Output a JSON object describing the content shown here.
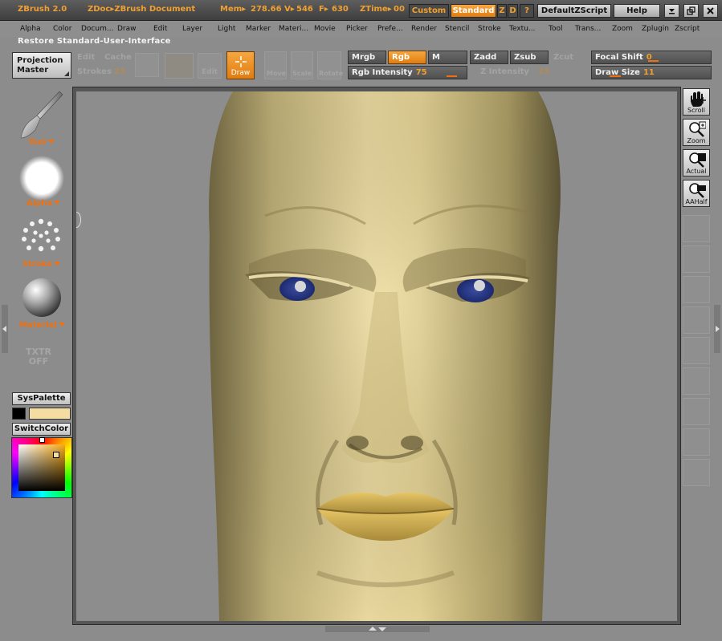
{
  "titlebar": {
    "app_name": "ZBrush 2.0",
    "document": "ZDoc▸ZBrush Document",
    "mem_label": "Mem▸",
    "mem_value": "278.66",
    "v_label": "V▸",
    "v_value": "546",
    "f_label": "F▸",
    "f_value": "630",
    "ztime_label": "ZTime▸",
    "ztime_value": "00",
    "custom": "Custom",
    "standard": "Standard",
    "z": "Z",
    "d": "D",
    "help_q": "?",
    "script": "DefaultZScript",
    "help": "Help",
    "minimize": "—",
    "restore": "❐",
    "close": "✕"
  },
  "menu": [
    "Alpha",
    "Color",
    "Docum...",
    "Draw",
    "Edit",
    "Layer",
    "Light",
    "Marker",
    "Materi...",
    "Movie",
    "Picker",
    "Prefe...",
    "Render",
    "Stencil",
    "Stroke",
    "Textu...",
    "Tool",
    "Trans...",
    "Zoom",
    "Zplugin",
    "Zscript"
  ],
  "status_text": "Restore Standard-User-Interface",
  "toolbar": {
    "projection_master": [
      "Projection",
      "Master"
    ],
    "edit": "Edit",
    "move": "Move",
    "scale": "Scale",
    "rotate": "Rotate",
    "draw": "Draw",
    "edit_faded": "Edit",
    "strokes": "Strokes",
    "strokes_value": "25",
    "cache": "Cache",
    "mrgb": "Mrgb",
    "rgb": "Rgb",
    "m": "M",
    "zadd": "Zadd",
    "zsub": "Zsub",
    "zcut": "Zcut",
    "rgb_intensity": "Rgb Intensity",
    "rgb_intensity_value": "75",
    "z_intensity": "Z Intensity",
    "z_intensity_value": "25",
    "focal_shift": "Focal Shift",
    "focal_shift_value": "0",
    "draw_size": "Draw Size",
    "draw_size_value": "11"
  },
  "left_shelf": {
    "tool": "Tool",
    "alpha": "Alpha",
    "stroke": "Stroke",
    "material": "Material",
    "texture_off": [
      "TXTR",
      "OFF"
    ],
    "syspalette": "SysPalette",
    "switchcolor": "SwitchColor",
    "main_color": "#f5dca0",
    "secondary_color": "#000000"
  },
  "right_shelf": {
    "scroll": "Scroll",
    "zoom": "Zoom",
    "actual": "Actual",
    "aahalf": "AAHalf"
  }
}
